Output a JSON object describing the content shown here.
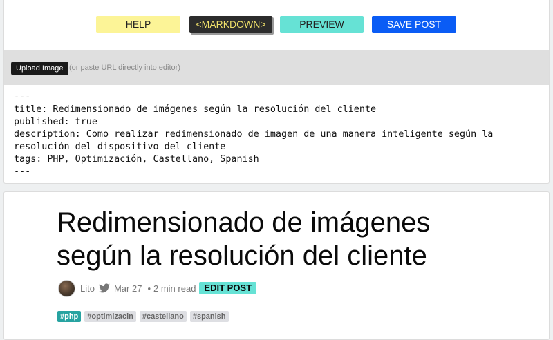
{
  "toolbar": {
    "help_label": "HELP",
    "markdown_label": "<MARKDOWN>",
    "preview_label": "PREVIEW",
    "save_label": "SAVE POST"
  },
  "upload": {
    "button_label": "Upload Image",
    "hint": "(or paste URL directly into editor)"
  },
  "editor": {
    "content": "---\ntitle: Redimensionado de imágenes según la resolución del cliente\npublished: true\ndescription: Como realizar redimensionado de imagen de una manera inteligente según la resolución del dispositivo del cliente\ntags: PHP, Optimización, Castellano, Spanish\n---"
  },
  "preview": {
    "title": "Redimensionado de imágenes según la resolución del cliente",
    "author": "Lito",
    "date": "Mar 27",
    "separator": "•",
    "read_time": "2 min read",
    "edit_label": "EDIT POST",
    "tags": [
      "#php",
      "#optimizacin",
      "#castellano",
      "#spanish"
    ]
  },
  "colors": {
    "help": "#fcf497",
    "markdown": "#2c2c2c",
    "preview": "#66e2d5",
    "save": "#0a5cf5",
    "tag_primary": "#27a3a1"
  },
  "icons": {
    "twitter": "twitter-icon"
  }
}
